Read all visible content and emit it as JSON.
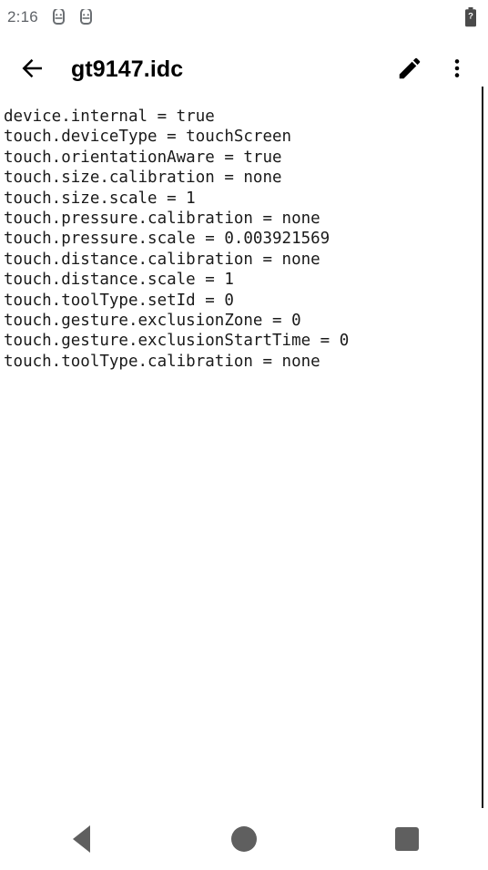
{
  "status_bar": {
    "clock": "2:16",
    "notification_icons": [
      "android-head-icon",
      "android-head-icon"
    ],
    "battery_icon": "battery-unknown-icon",
    "battery_glyph": "?"
  },
  "app_bar": {
    "back_icon": "arrow-back-icon",
    "title": "gt9147.idc",
    "edit_icon": "edit-pencil-icon",
    "overflow_icon": "more-vert-icon"
  },
  "file_content": {
    "lines": [
      "device.internal = true",
      "touch.deviceType = touchScreen",
      "touch.orientationAware = true",
      "touch.size.calibration = none",
      "touch.size.scale = 1",
      "touch.pressure.calibration = none",
      "touch.pressure.scale = 0.003921569",
      "touch.distance.calibration = none",
      "touch.distance.scale = 1",
      "touch.toolType.setId = 0",
      "touch.gesture.exclusionZone = 0",
      "touch.gesture.exclusionStartTime = 0",
      "touch.toolType.calibration = none"
    ]
  },
  "nav_bar": {
    "back_label": "Back",
    "home_label": "Home",
    "recents_label": "Recents"
  },
  "colors": {
    "background": "#ffffff",
    "text": "#1a1a1a",
    "status_text": "#5f6368",
    "nav_icon": "#5f5f5f",
    "scroll_indicator": "#141414"
  }
}
